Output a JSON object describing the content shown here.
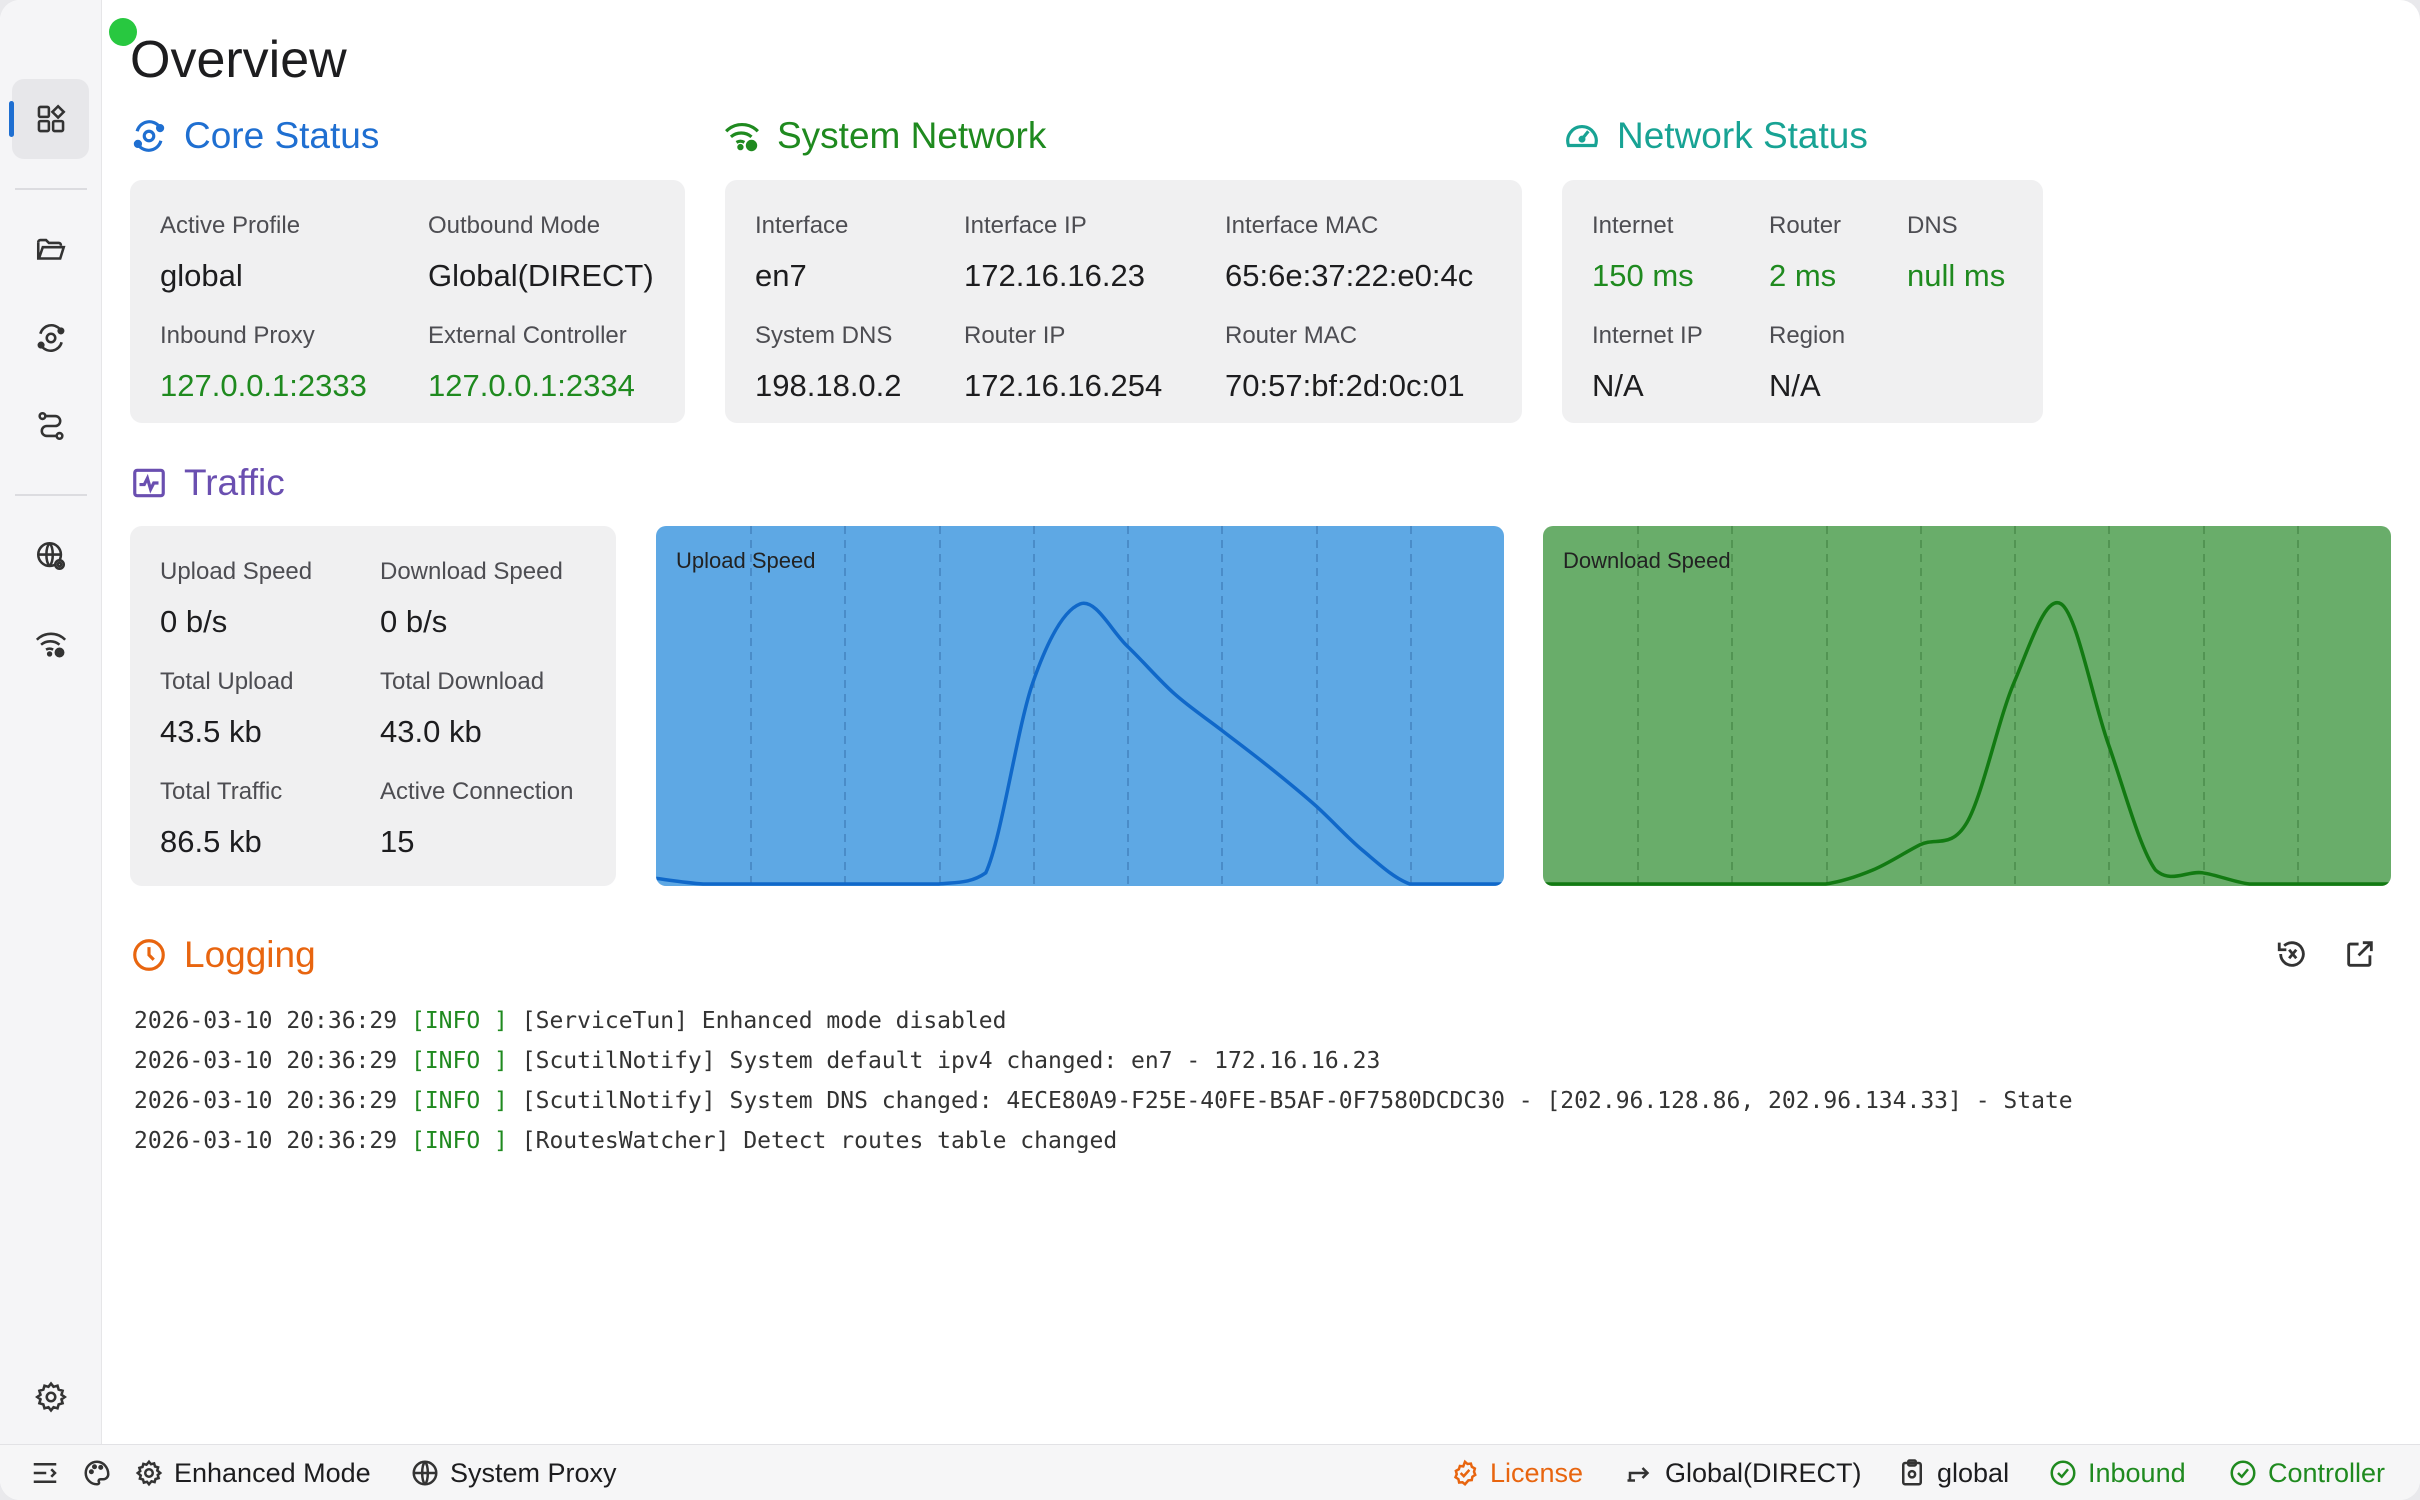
{
  "page": {
    "title": "Overview"
  },
  "colors": {
    "core_status": "#1f6fd1",
    "system_network": "#1f8a1f",
    "network_status": "#18a394",
    "traffic": "#6a4fb0",
    "logging": "#e8650f",
    "upload_fill": "#5ea8e4",
    "upload_line": "#1068c9",
    "download_fill": "#69ad6a",
    "download_line": "#127a12"
  },
  "sidebar": {
    "items": [
      {
        "name": "overview",
        "icon": "dashboard-icon",
        "active": true
      },
      {
        "name": "profiles",
        "icon": "folder-icon"
      },
      {
        "name": "connections",
        "icon": "orbit-icon"
      },
      {
        "name": "rules",
        "icon": "route-icon"
      },
      {
        "name": "network",
        "icon": "globe-gear-icon"
      },
      {
        "name": "wifi",
        "icon": "wifi-gear-icon"
      },
      {
        "name": "settings",
        "icon": "gear-icon"
      }
    ]
  },
  "core_status": {
    "title": "Core Status",
    "active_profile_label": "Active Profile",
    "active_profile": "global",
    "outbound_mode_label": "Outbound Mode",
    "outbound_mode": "Global(DIRECT)",
    "inbound_proxy_label": "Inbound Proxy",
    "inbound_proxy": "127.0.0.1:2333",
    "external_controller_label": "External Controller",
    "external_controller": "127.0.0.1:2334"
  },
  "system_network": {
    "title": "System Network",
    "interface_label": "Interface",
    "interface": "en7",
    "interface_ip_label": "Interface IP",
    "interface_ip": "172.16.16.23",
    "interface_mac_label": "Interface MAC",
    "interface_mac": "65:6e:37:22:e0:4c",
    "system_dns_label": "System DNS",
    "system_dns": "198.18.0.2",
    "router_ip_label": "Router IP",
    "router_ip": "172.16.16.254",
    "router_mac_label": "Router MAC",
    "router_mac": "70:57:bf:2d:0c:01"
  },
  "network_status": {
    "title": "Network Status",
    "internet_label": "Internet",
    "internet": "150 ms",
    "router_label": "Router",
    "router": "2 ms",
    "dns_label": "DNS",
    "dns": "null ms",
    "internet_ip_label": "Internet IP",
    "internet_ip": "N/A",
    "region_label": "Region",
    "region": "N/A"
  },
  "traffic": {
    "title": "Traffic",
    "upload_speed_label": "Upload Speed",
    "upload_speed": "0 b/s",
    "download_speed_label": "Download Speed",
    "download_speed": "0 b/s",
    "total_upload_label": "Total Upload",
    "total_upload": "43.5 kb",
    "total_download_label": "Total Download",
    "total_download": "43.0 kb",
    "total_traffic_label": "Total Traffic",
    "total_traffic": "86.5 kb",
    "active_connection_label": "Active Connection",
    "active_connection": "15"
  },
  "chart_data": [
    {
      "type": "area",
      "title": "Upload Speed",
      "x": [
        0,
        1,
        2,
        3,
        4,
        5,
        6,
        7,
        8,
        9,
        10,
        11,
        12,
        13,
        14,
        15,
        16,
        17,
        18
      ],
      "values": [
        0.02,
        0.0,
        0.0,
        0.0,
        0.0,
        0.0,
        0.0,
        0.04,
        0.72,
        1.0,
        0.85,
        0.68,
        0.55,
        0.42,
        0.28,
        0.12,
        0.0,
        0.0,
        0.0
      ],
      "ylim": [
        0,
        1.1
      ],
      "grid": "vertical dashed"
    },
    {
      "type": "area",
      "title": "Download Speed",
      "x": [
        0,
        1,
        2,
        3,
        4,
        5,
        6,
        7,
        8,
        9,
        10,
        11,
        12,
        13,
        14,
        15,
        16,
        17,
        18
      ],
      "values": [
        0.0,
        0.0,
        0.0,
        0.0,
        0.0,
        0.0,
        0.0,
        0.05,
        0.14,
        0.22,
        0.72,
        1.0,
        0.5,
        0.05,
        0.04,
        0.0,
        0.0,
        0.0,
        0.0
      ],
      "ylim": [
        0,
        1.1
      ],
      "grid": "vertical dashed"
    }
  ],
  "logging": {
    "title": "Logging",
    "lines": [
      {
        "ts": "2026-03-10 20:36:29",
        "level": "[INFO ]",
        "msg": "[ServiceTun] Enhanced mode disabled"
      },
      {
        "ts": "2026-03-10 20:36:29",
        "level": "[INFO ]",
        "msg": "[ScutilNotify] System default ipv4 changed: en7 - 172.16.16.23"
      },
      {
        "ts": "2026-03-10 20:36:29",
        "level": "[INFO ]",
        "msg": "[ScutilNotify] System DNS changed: 4ECE80A9-F25E-40FE-B5AF-0F7580DCDC30 - [202.96.128.86, 202.96.134.33] - State"
      },
      {
        "ts": "2026-03-10 20:36:29",
        "level": "[INFO ]",
        "msg": "[RoutesWatcher] Detect routes table changed"
      }
    ]
  },
  "statusbar": {
    "enhanced_mode": "Enhanced Mode",
    "system_proxy": "System Proxy",
    "license": "License",
    "outbound_mode": "Global(DIRECT)",
    "profile": "global",
    "inbound": "Inbound",
    "controller": "Controller"
  }
}
